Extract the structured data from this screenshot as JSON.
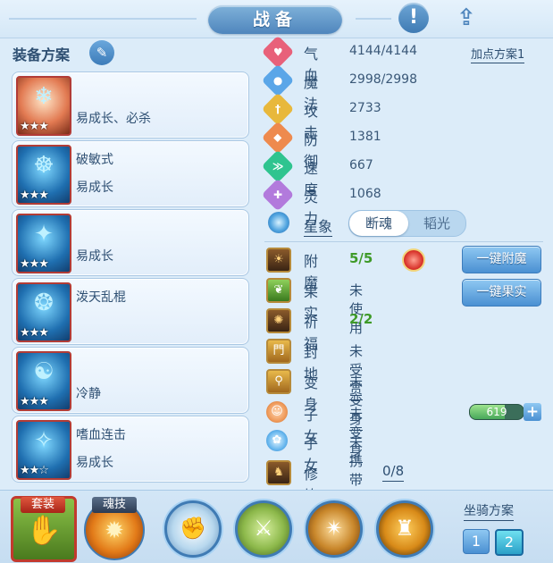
{
  "header": {
    "title": "战备",
    "info_icon": "exclamation-icon",
    "share_icon": "share-icon"
  },
  "left": {
    "title": "装备方案",
    "edit_icon": "pencil-icon",
    "plans": [
      {
        "name": "",
        "effect": "易成长、必杀",
        "stars": "★★★"
      },
      {
        "name": "破敏式",
        "effect": "易成长",
        "stars": "★★★"
      },
      {
        "name": "",
        "effect": "易成长",
        "stars": "★★★"
      },
      {
        "name": "泼天乱棍",
        "effect": "",
        "stars": "★★★"
      },
      {
        "name": "",
        "effect": "冷静",
        "stars": "★★★"
      },
      {
        "name": "嗜血连击",
        "effect": "易成长",
        "stars": "★★☆"
      }
    ]
  },
  "stats": {
    "add_point_plan": "加点方案1",
    "rows": [
      {
        "label": "气血",
        "value": "4144/4144",
        "color": "#e8617a",
        "icon": "heart-icon"
      },
      {
        "label": "魔法",
        "value": "2998/2998",
        "color": "#5aa6e8",
        "icon": "mana-icon"
      },
      {
        "label": "攻击",
        "value": "2733",
        "color": "#e8b83c",
        "icon": "sword-icon"
      },
      {
        "label": "防御",
        "value": "1381",
        "color": "#ee8a4e",
        "icon": "shield-icon"
      },
      {
        "label": "速度",
        "value": "667",
        "color": "#2fc48f",
        "icon": "speed-icon"
      },
      {
        "label": "灵力",
        "value": "1068",
        "color": "#b27adc",
        "icon": "spirit-icon"
      }
    ],
    "star_sign": {
      "label": "星象",
      "active": "断魂",
      "inactive": "韬光"
    }
  },
  "details": {
    "rows": [
      {
        "label": "附魔",
        "value": "5/5",
        "style": "green"
      },
      {
        "label": "果实",
        "value": "未使用",
        "style": "plain"
      },
      {
        "label": "祈福",
        "value": "2/2",
        "style": "green"
      },
      {
        "label": "封地",
        "value": "未受赏",
        "style": "ul"
      },
      {
        "label": "变身",
        "value": "未变身",
        "style": "ul"
      },
      {
        "label": "子女",
        "value": "未变身",
        "style": "ul"
      },
      {
        "label": "子女",
        "value": "未携带",
        "style": "ul"
      },
      {
        "label": "修炼觉醒",
        "value": "0/8",
        "style": "ul"
      }
    ],
    "enchant_button": "一键附魔",
    "fruit_button": "一键果实",
    "child_exp": {
      "value": "619",
      "fill_percent": 65
    },
    "plus": "+"
  },
  "bottom": {
    "suit_label": "套装",
    "soul_label": "魂技",
    "mount_title": "坐骑方案",
    "mount_options": [
      "1",
      "2"
    ],
    "mount_active": "2"
  }
}
